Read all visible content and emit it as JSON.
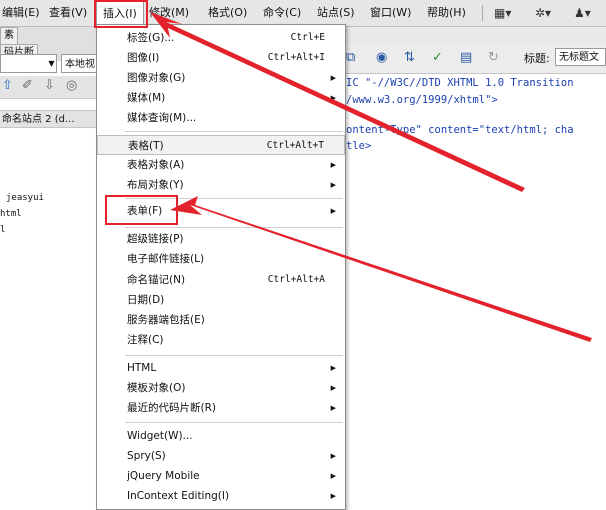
{
  "menubar": {
    "items": [
      "编辑(E)",
      "查看(V)",
      "插入(I)",
      "修改(M)",
      "格式(O)",
      "命令(C)",
      "站点(S)",
      "窗口(W)",
      "帮助(H)"
    ],
    "icons": [
      "layout-icon",
      "gear-icon",
      "extend-icon"
    ]
  },
  "left_panel": {
    "tab1": "素",
    "tab2": "码片断",
    "select_value": "",
    "view_select": "本地视",
    "site_label": "命名站点 2 (d...",
    "files": [
      "jeasyui",
      "html",
      "l"
    ]
  },
  "code_view": {
    "title_label": "标题:",
    "title_value": "无标题文",
    "lines": [
      "IC \"-//W3C//DTD XHTML 1.0 Transition",
      "/www.w3.org/1999/xhtml\">",
      "ontent-Type\" content=\"text/html; cha",
      "tle>"
    ]
  },
  "insert_menu": {
    "items": [
      {
        "label": "标签(G)...",
        "shortcut": "Ctrl+E"
      },
      {
        "label": "图像(I)",
        "shortcut": "Ctrl+Alt+I"
      },
      {
        "label": "图像对象(G)",
        "submenu": true
      },
      {
        "label": "媒体(M)",
        "submenu": true
      },
      {
        "label": "媒体查询(M)..."
      },
      {
        "label": "表格(T)",
        "shortcut": "Ctrl+Alt+T"
      },
      {
        "label": "表格对象(A)",
        "submenu": true
      },
      {
        "label": "布局对象(Y)",
        "submenu": true
      },
      {
        "label": "表单(F)",
        "submenu": true
      },
      {
        "label": "超级链接(P)"
      },
      {
        "label": "电子邮件链接(L)"
      },
      {
        "label": "命名锚记(N)",
        "shortcut": "Ctrl+Alt+A"
      },
      {
        "label": "日期(D)"
      },
      {
        "label": "服务器端包括(E)"
      },
      {
        "label": "注释(C)"
      },
      {
        "label": "HTML",
        "submenu": true
      },
      {
        "label": "模板对象(O)",
        "submenu": true
      },
      {
        "label": "最近的代码片断(R)",
        "submenu": true
      },
      {
        "label": "Widget(W)..."
      },
      {
        "label": "Spry(S)",
        "submenu": true
      },
      {
        "label": "jQuery Mobile",
        "submenu": true
      },
      {
        "label": "InContext Editing(I)",
        "submenu": true
      }
    ]
  },
  "colors": {
    "annotation_red": "#e3222b",
    "code_blue": "#1a3fb0"
  }
}
